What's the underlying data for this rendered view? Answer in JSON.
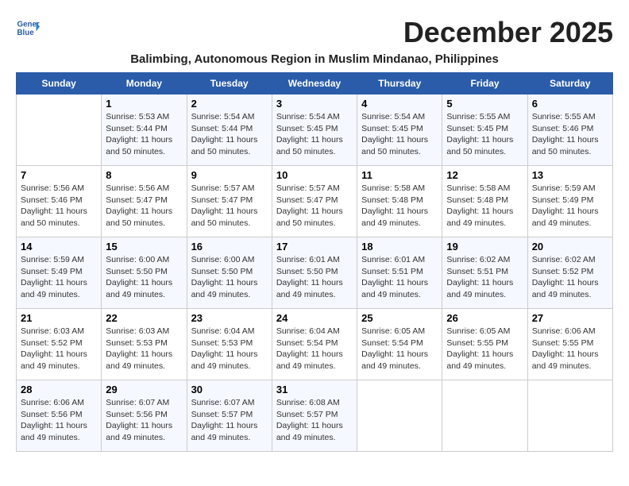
{
  "header": {
    "logo_line1": "General",
    "logo_line2": "Blue",
    "month_year": "December 2025",
    "subtitle": "Balimbing, Autonomous Region in Muslim Mindanao, Philippines"
  },
  "days_of_week": [
    "Sunday",
    "Monday",
    "Tuesday",
    "Wednesday",
    "Thursday",
    "Friday",
    "Saturday"
  ],
  "weeks": [
    [
      {
        "day": "",
        "info": ""
      },
      {
        "day": "1",
        "info": "Sunrise: 5:53 AM\nSunset: 5:44 PM\nDaylight: 11 hours\nand 50 minutes."
      },
      {
        "day": "2",
        "info": "Sunrise: 5:54 AM\nSunset: 5:44 PM\nDaylight: 11 hours\nand 50 minutes."
      },
      {
        "day": "3",
        "info": "Sunrise: 5:54 AM\nSunset: 5:45 PM\nDaylight: 11 hours\nand 50 minutes."
      },
      {
        "day": "4",
        "info": "Sunrise: 5:54 AM\nSunset: 5:45 PM\nDaylight: 11 hours\nand 50 minutes."
      },
      {
        "day": "5",
        "info": "Sunrise: 5:55 AM\nSunset: 5:45 PM\nDaylight: 11 hours\nand 50 minutes."
      },
      {
        "day": "6",
        "info": "Sunrise: 5:55 AM\nSunset: 5:46 PM\nDaylight: 11 hours\nand 50 minutes."
      }
    ],
    [
      {
        "day": "7",
        "info": "Sunrise: 5:56 AM\nSunset: 5:46 PM\nDaylight: 11 hours\nand 50 minutes."
      },
      {
        "day": "8",
        "info": "Sunrise: 5:56 AM\nSunset: 5:47 PM\nDaylight: 11 hours\nand 50 minutes."
      },
      {
        "day": "9",
        "info": "Sunrise: 5:57 AM\nSunset: 5:47 PM\nDaylight: 11 hours\nand 50 minutes."
      },
      {
        "day": "10",
        "info": "Sunrise: 5:57 AM\nSunset: 5:47 PM\nDaylight: 11 hours\nand 50 minutes."
      },
      {
        "day": "11",
        "info": "Sunrise: 5:58 AM\nSunset: 5:48 PM\nDaylight: 11 hours\nand 49 minutes."
      },
      {
        "day": "12",
        "info": "Sunrise: 5:58 AM\nSunset: 5:48 PM\nDaylight: 11 hours\nand 49 minutes."
      },
      {
        "day": "13",
        "info": "Sunrise: 5:59 AM\nSunset: 5:49 PM\nDaylight: 11 hours\nand 49 minutes."
      }
    ],
    [
      {
        "day": "14",
        "info": "Sunrise: 5:59 AM\nSunset: 5:49 PM\nDaylight: 11 hours\nand 49 minutes."
      },
      {
        "day": "15",
        "info": "Sunrise: 6:00 AM\nSunset: 5:50 PM\nDaylight: 11 hours\nand 49 minutes."
      },
      {
        "day": "16",
        "info": "Sunrise: 6:00 AM\nSunset: 5:50 PM\nDaylight: 11 hours\nand 49 minutes."
      },
      {
        "day": "17",
        "info": "Sunrise: 6:01 AM\nSunset: 5:50 PM\nDaylight: 11 hours\nand 49 minutes."
      },
      {
        "day": "18",
        "info": "Sunrise: 6:01 AM\nSunset: 5:51 PM\nDaylight: 11 hours\nand 49 minutes."
      },
      {
        "day": "19",
        "info": "Sunrise: 6:02 AM\nSunset: 5:51 PM\nDaylight: 11 hours\nand 49 minutes."
      },
      {
        "day": "20",
        "info": "Sunrise: 6:02 AM\nSunset: 5:52 PM\nDaylight: 11 hours\nand 49 minutes."
      }
    ],
    [
      {
        "day": "21",
        "info": "Sunrise: 6:03 AM\nSunset: 5:52 PM\nDaylight: 11 hours\nand 49 minutes."
      },
      {
        "day": "22",
        "info": "Sunrise: 6:03 AM\nSunset: 5:53 PM\nDaylight: 11 hours\nand 49 minutes."
      },
      {
        "day": "23",
        "info": "Sunrise: 6:04 AM\nSunset: 5:53 PM\nDaylight: 11 hours\nand 49 minutes."
      },
      {
        "day": "24",
        "info": "Sunrise: 6:04 AM\nSunset: 5:54 PM\nDaylight: 11 hours\nand 49 minutes."
      },
      {
        "day": "25",
        "info": "Sunrise: 6:05 AM\nSunset: 5:54 PM\nDaylight: 11 hours\nand 49 minutes."
      },
      {
        "day": "26",
        "info": "Sunrise: 6:05 AM\nSunset: 5:55 PM\nDaylight: 11 hours\nand 49 minutes."
      },
      {
        "day": "27",
        "info": "Sunrise: 6:06 AM\nSunset: 5:55 PM\nDaylight: 11 hours\nand 49 minutes."
      }
    ],
    [
      {
        "day": "28",
        "info": "Sunrise: 6:06 AM\nSunset: 5:56 PM\nDaylight: 11 hours\nand 49 minutes."
      },
      {
        "day": "29",
        "info": "Sunrise: 6:07 AM\nSunset: 5:56 PM\nDaylight: 11 hours\nand 49 minutes."
      },
      {
        "day": "30",
        "info": "Sunrise: 6:07 AM\nSunset: 5:57 PM\nDaylight: 11 hours\nand 49 minutes."
      },
      {
        "day": "31",
        "info": "Sunrise: 6:08 AM\nSunset: 5:57 PM\nDaylight: 11 hours\nand 49 minutes."
      },
      {
        "day": "",
        "info": ""
      },
      {
        "day": "",
        "info": ""
      },
      {
        "day": "",
        "info": ""
      }
    ]
  ]
}
